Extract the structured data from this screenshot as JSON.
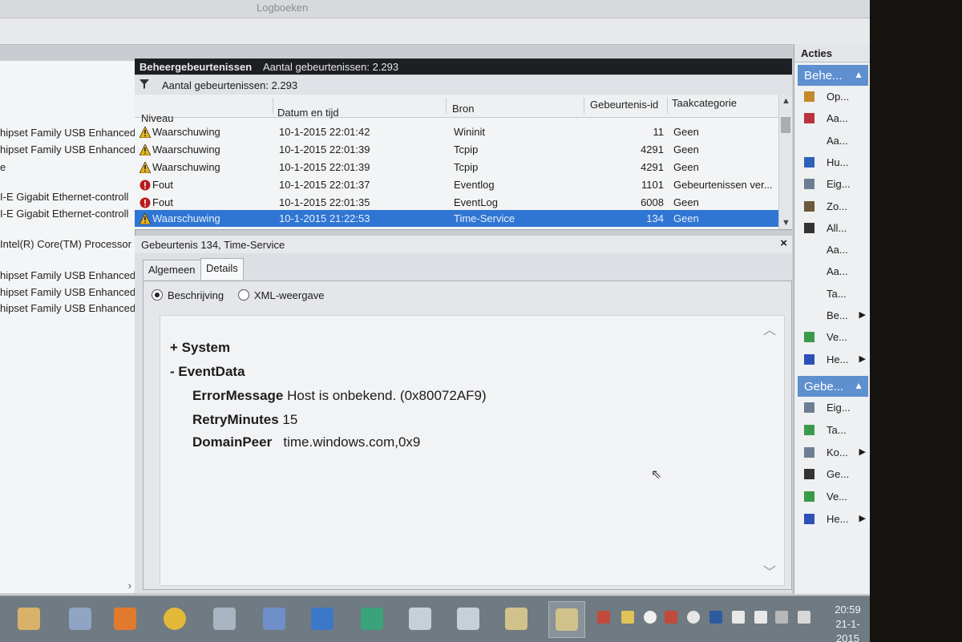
{
  "window": {
    "title": "Logboeken"
  },
  "left_pane": {
    "items": [
      "hipset Family USB Enhanced",
      "hipset Family USB Enhanced",
      "e",
      "I-E Gigabit Ethernet-controll",
      "I-E Gigabit Ethernet-controll",
      "Intel(R) Core(TM) Processor",
      "hipset Family USB Enhanced",
      "hipset Family USB Enhanced",
      "hipset Family USB Enhanced"
    ],
    "scroll_right": "›"
  },
  "center": {
    "header_title": "Beheergebeurtenissen",
    "header_count": "Aantal gebeurtenissen: 2.293",
    "filter_text": "Aantal gebeurtenissen: 2.293",
    "columns": [
      "Niveau",
      "Datum en tijd",
      "Bron",
      "Gebeurtenis-id",
      "Taakcategorie"
    ],
    "rows": [
      {
        "level": "Waarschuwing",
        "type": "warning",
        "datetime": "10-1-2015 22:01:42",
        "source": "Wininit",
        "id": "11",
        "category": "Geen"
      },
      {
        "level": "Waarschuwing",
        "type": "warning",
        "datetime": "10-1-2015 22:01:39",
        "source": "Tcpip",
        "id": "4291",
        "category": "Geen"
      },
      {
        "level": "Waarschuwing",
        "type": "warning",
        "datetime": "10-1-2015 22:01:39",
        "source": "Tcpip",
        "id": "4291",
        "category": "Geen"
      },
      {
        "level": "Fout",
        "type": "error",
        "datetime": "10-1-2015 22:01:37",
        "source": "Eventlog",
        "id": "1101",
        "category": "Gebeurtenissen ver..."
      },
      {
        "level": "Fout",
        "type": "error",
        "datetime": "10-1-2015 22:01:35",
        "source": "EventLog",
        "id": "6008",
        "category": "Geen"
      },
      {
        "level": "Waarschuwing",
        "type": "warning",
        "datetime": "10-1-2015 21:22:53",
        "source": "Time-Service",
        "id": "134",
        "category": "Geen"
      }
    ],
    "selected_row": 5
  },
  "detail": {
    "title": "Gebeurtenis 134, Time-Service",
    "close": "×",
    "tabs": [
      "Algemeen",
      "Details"
    ],
    "active_tab": "Details",
    "radio_options": [
      "Beschrijving",
      "XML-weergave"
    ],
    "selected_radio": "Beschrijving",
    "system_label": "+ System",
    "eventdata_label": "- EventData",
    "fields": [
      {
        "key": "ErrorMessage",
        "value": "Host is onbekend. (0x80072AF9)"
      },
      {
        "key": "RetryMinutes",
        "value": "15"
      },
      {
        "key": "DomainPeer",
        "value": "time.windows.com,0x9"
      }
    ]
  },
  "actions": {
    "title": "Acties",
    "section1": "Behe...",
    "section1_items": [
      "Op...",
      "Aa...",
      "Aa...",
      "Hu...",
      "Eig...",
      "Zo...",
      "All...",
      "Aa...",
      "Aa...",
      "Ta...",
      "Be...",
      "Ve...",
      "He..."
    ],
    "section2": "Gebe...",
    "section2_items": [
      "Eig...",
      "Ta...",
      "Ko...",
      "Ge...",
      "Ve...",
      "He..."
    ]
  },
  "taskbar": {
    "time": "20:59",
    "date": "21-1-2015"
  },
  "colors": {
    "selection": "#2f76d4",
    "section_header": "#5e8fcf",
    "warning": "#e7b416",
    "error": "#b81c1c",
    "header_dark": "#1d1f22"
  }
}
